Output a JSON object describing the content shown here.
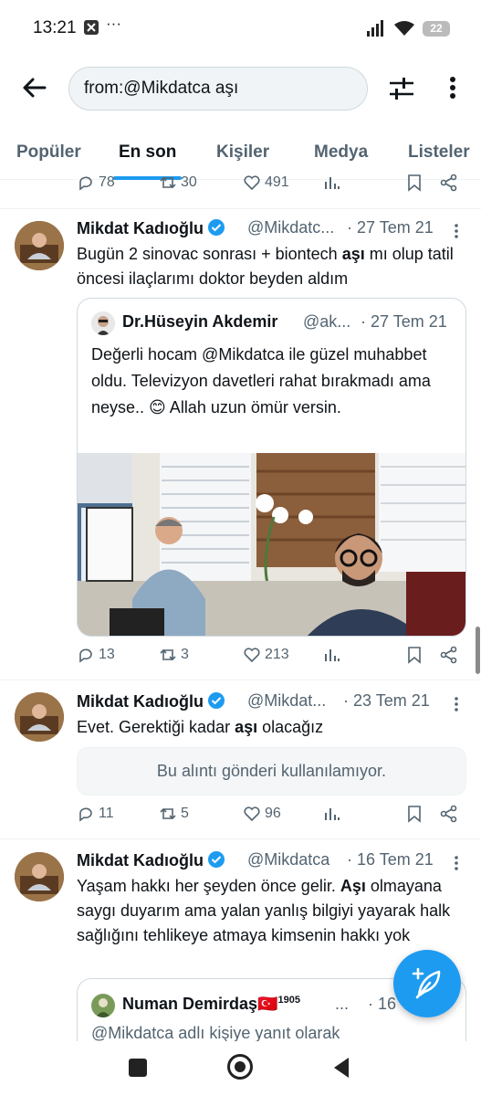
{
  "status_bar": {
    "time": "13:21",
    "battery": "22",
    "notif_extra": "···"
  },
  "search": {
    "query": "from:@Mikdatca aşı"
  },
  "tabs": [
    {
      "label": "Popüler"
    },
    {
      "label": "En son",
      "active": true
    },
    {
      "label": "Kişiler"
    },
    {
      "label": "Medya"
    },
    {
      "label": "Listeler"
    }
  ],
  "prev_actions": {
    "replies": "78",
    "retweets": "30",
    "likes": "491"
  },
  "tweets": [
    {
      "author": "Mikdat Kadıoğlu",
      "handle": "@Mikdatc...",
      "date": "· 27 Tem 21",
      "text_parts": [
        "Bugün 2 sinovac sonrası + biontech ",
        "aşı",
        " mı olup tatil öncesi ilaçlarımı doktor beyden aldım"
      ],
      "quote": {
        "author": "Dr.Hüseyin Akdemir",
        "handle": "@ak...",
        "date": "· 27 Tem 21",
        "text": "Değerli hocam @Mikdatca ile güzel muhabbet oldu. Televizyon davetleri rahat bırakmadı ama neyse.. 😊 Allah uzun ömür versin."
      },
      "actions": {
        "replies": "13",
        "retweets": "3",
        "likes": "213"
      }
    },
    {
      "author": "Mikdat Kadıoğlu",
      "handle": "@Mikdat...",
      "date": "· 23 Tem 21",
      "text_parts": [
        "Evet. Gerektiği kadar ",
        "aşı",
        " olacağız"
      ],
      "unavailable": "Bu alıntı gönderi kullanılamıyor.",
      "actions": {
        "replies": "11",
        "retweets": "5",
        "likes": "96"
      }
    },
    {
      "author": "Mikdat Kadıoğlu",
      "handle": "@Mikdatca",
      "date": "· 16 Tem 21",
      "text_parts": [
        "Yaşam hakkı her şeyden önce gelir. ",
        "Aşı",
        " olmayana saygı duyarım ama yalan yanlış bilgiyi yayarak halk sağlığını tehlikeye atmaya kimsenin hakkı yok"
      ],
      "quote": {
        "author": "Numan Demirdaş🇹🇷",
        "author_sup": "1905",
        "handle": "...",
        "date": "· 16 T",
        "text": "@Mikdatca adlı kişiye yanıt olarak"
      }
    }
  ],
  "colors": {
    "accent": "#1d9bf0",
    "secondary_text": "#536471",
    "border": "#cfd9de"
  }
}
